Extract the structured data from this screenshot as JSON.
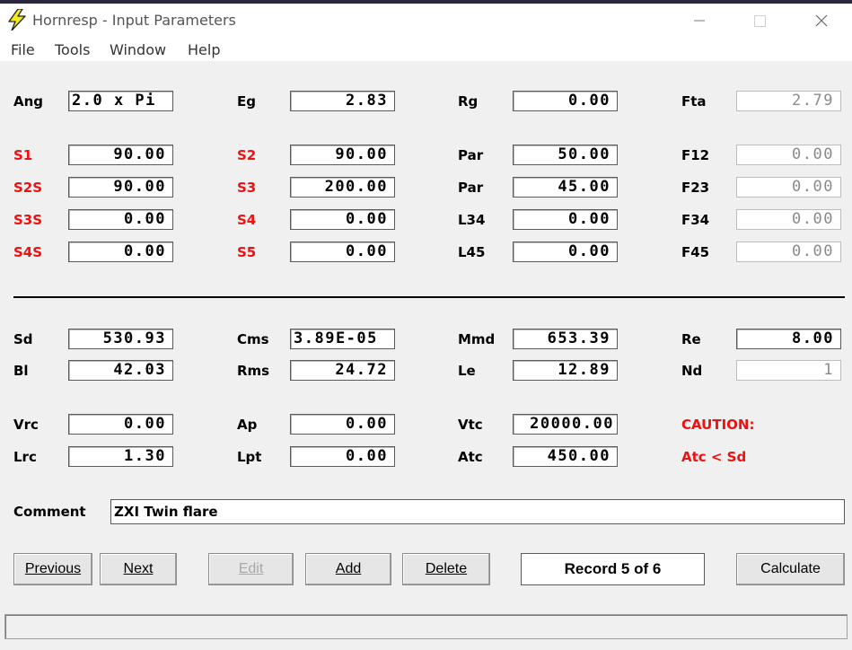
{
  "window": {
    "title": "Hornresp - Input Parameters",
    "icon": "lightning-icon",
    "controls": [
      "minimize-icon",
      "maximize-icon",
      "close-icon"
    ]
  },
  "menu": [
    "File",
    "Tools",
    "Window",
    "Help"
  ],
  "horn": {
    "ang": {
      "label": "Ang",
      "value": "2.0 x Pi"
    },
    "eg": {
      "label": "Eg",
      "value": "2.83"
    },
    "rg": {
      "label": "Rg",
      "value": "0.00"
    },
    "fta": {
      "label": "Fta",
      "value": "2.79"
    },
    "s1": {
      "label": "S1",
      "value": "90.00"
    },
    "s2": {
      "label": "S2",
      "value": "90.00"
    },
    "par1": {
      "label": "Par",
      "value": "50.00"
    },
    "f12": {
      "label": "F12",
      "value": "0.00"
    },
    "s2s": {
      "label": "S2S",
      "value": "90.00"
    },
    "s3": {
      "label": "S3",
      "value": "200.00"
    },
    "par2": {
      "label": "Par",
      "value": "45.00"
    },
    "f23": {
      "label": "F23",
      "value": "0.00"
    },
    "s3s": {
      "label": "S3S",
      "value": "0.00"
    },
    "s4": {
      "label": "S4",
      "value": "0.00"
    },
    "l34": {
      "label": "L34",
      "value": "0.00"
    },
    "f34": {
      "label": "F34",
      "value": "0.00"
    },
    "s4s": {
      "label": "S4S",
      "value": "0.00"
    },
    "s5": {
      "label": "S5",
      "value": "0.00"
    },
    "l45": {
      "label": "L45",
      "value": "0.00"
    },
    "f45": {
      "label": "F45",
      "value": "0.00"
    }
  },
  "driver": {
    "sd": {
      "label": "Sd",
      "value": "530.93"
    },
    "cms": {
      "label": "Cms",
      "value": "3.89E-05"
    },
    "mmd": {
      "label": "Mmd",
      "value": "653.39"
    },
    "re": {
      "label": "Re",
      "value": "8.00"
    },
    "bl": {
      "label": "Bl",
      "value": "42.03"
    },
    "rms": {
      "label": "Rms",
      "value": "24.72"
    },
    "le": {
      "label": "Le",
      "value": "12.89"
    },
    "nd": {
      "label": "Nd",
      "value": "1"
    }
  },
  "chambers": {
    "vrc": {
      "label": "Vrc",
      "value": "0.00"
    },
    "ap": {
      "label": "Ap",
      "value": "0.00"
    },
    "vtc": {
      "label": "Vtc",
      "value": "20000.00"
    },
    "lrc": {
      "label": "Lrc",
      "value": "1.30"
    },
    "lpt": {
      "label": "Lpt",
      "value": "0.00"
    },
    "atc": {
      "label": "Atc",
      "value": "450.00"
    }
  },
  "caution": {
    "title": "CAUTION:",
    "message": "Atc < Sd",
    "color": "#ee1111"
  },
  "comment": {
    "label": "Comment",
    "value": "ZXI Twin flare"
  },
  "buttons": {
    "previous": "Previous",
    "next": "Next",
    "edit": "Edit",
    "add": "Add",
    "delete": "Delete",
    "calculate": "Calculate"
  },
  "record": "Record 5 of 6",
  "status": ""
}
